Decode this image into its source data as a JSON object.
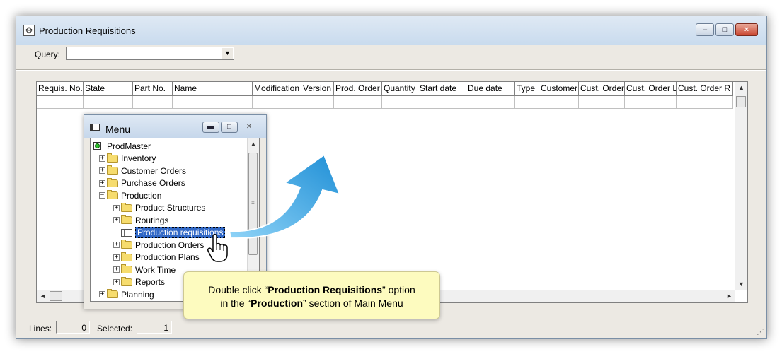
{
  "window": {
    "title": "Production Requisitions",
    "buttons": {
      "minimize": "–",
      "maximize": "□",
      "close": "×"
    }
  },
  "query": {
    "label": "Query:",
    "value": "",
    "dropdown_arrow": "▼"
  },
  "grid": {
    "columns": [
      {
        "label": "Requis. No.",
        "w": 66
      },
      {
        "label": "State",
        "w": 70
      },
      {
        "label": "Part No.",
        "w": 56
      },
      {
        "label": "Name",
        "w": 113
      },
      {
        "label": "Modification",
        "w": 69
      },
      {
        "label": "Version",
        "w": 46
      },
      {
        "label": "Prod. Order",
        "w": 68
      },
      {
        "label": "Quantity",
        "w": 51
      },
      {
        "label": "Start date",
        "w": 68
      },
      {
        "label": "Due date",
        "w": 69
      },
      {
        "label": "Type",
        "w": 34
      },
      {
        "label": "Customer",
        "w": 56
      },
      {
        "label": "Cust. Order",
        "w": 65
      },
      {
        "label": "Cust. Order L",
        "w": 73
      },
      {
        "label": "Cust. Order R",
        "w": 80
      }
    ],
    "scroll": {
      "up": "▲",
      "down": "▼",
      "left": "◄",
      "right": "►"
    }
  },
  "status": {
    "lines_label": "Lines:",
    "lines_value": "0",
    "selected_label": "Selected:",
    "selected_value": "1",
    "grip": "⋰"
  },
  "menu": {
    "title": "Menu",
    "buttons": {
      "minimize": "▬",
      "maximize": "□",
      "close": "✕"
    },
    "tree": [
      {
        "label": "ProdMaster",
        "level": 0,
        "kind": "root"
      },
      {
        "label": "Inventory",
        "level": 1,
        "kind": "folder",
        "expander": "+"
      },
      {
        "label": "Customer Orders",
        "level": 1,
        "kind": "folder",
        "expander": "+"
      },
      {
        "label": "Purchase Orders",
        "level": 1,
        "kind": "folder",
        "expander": "+"
      },
      {
        "label": "Production",
        "level": 1,
        "kind": "folder-open",
        "expander": "−"
      },
      {
        "label": "Product Structures",
        "level": 2,
        "kind": "folder",
        "expander": "+"
      },
      {
        "label": "Routings",
        "level": 2,
        "kind": "folder",
        "expander": "+"
      },
      {
        "label": "Production requisitions",
        "level": 2,
        "kind": "grid",
        "selected": true
      },
      {
        "label": "Production Orders",
        "level": 2,
        "kind": "folder",
        "expander": "+"
      },
      {
        "label": "Production Plans",
        "level": 2,
        "kind": "folder",
        "expander": "+"
      },
      {
        "label": "Work Time",
        "level": 2,
        "kind": "folder",
        "expander": "+"
      },
      {
        "label": "Reports",
        "level": 2,
        "kind": "folder",
        "expander": "+"
      },
      {
        "label": "Planning",
        "level": 1,
        "kind": "folder",
        "expander": "+"
      }
    ],
    "scroll": {
      "up": "▲",
      "grip": "≡"
    }
  },
  "callout": {
    "line1_pre": "Double click “",
    "line1_bold": "Production Requisitions",
    "line1_post": "” option",
    "line2_pre": "in the “",
    "line2_bold": "Production",
    "line2_post": "” section of Main Menu"
  },
  "colors": {
    "arrow_light": "#8fd3f7",
    "arrow_dark": "#1f8fd6",
    "selection": "#3168c6"
  }
}
